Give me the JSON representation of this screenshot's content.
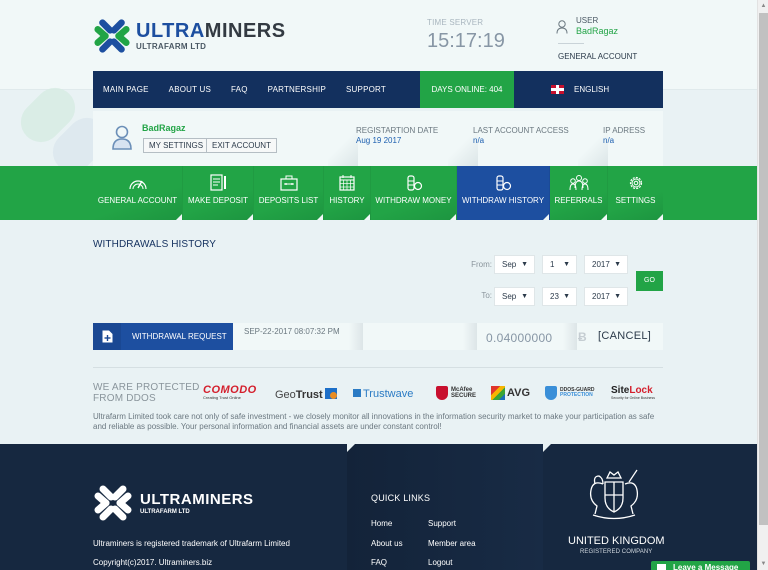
{
  "header": {
    "brand_part1": "ULTRA",
    "brand_part2": "MINERS",
    "brand_sub": "ULTRAFARM LTD",
    "time_label": "TIME SERVER",
    "time_value": "15:17:19",
    "user_label": "USER",
    "user_name": "BadRagaz",
    "account_type": "GENERAL ACCOUNT"
  },
  "nav": {
    "items": [
      {
        "label": "MAIN PAGE"
      },
      {
        "label": "ABOUT US"
      },
      {
        "label": "FAQ"
      },
      {
        "label": "PARTNERSHIP"
      },
      {
        "label": "SUPPORT"
      }
    ],
    "days_online": "DAYS ONLINE: 404",
    "language": "ENGLISH"
  },
  "account": {
    "name": "BadRagaz",
    "settings_button": "MY SETTINGS",
    "exit_button": "EXIT ACCOUNT",
    "reg_label": "REGISTARTION DATE",
    "reg_value": "Aug 19 2017",
    "last_label": "LAST ACCOUNT ACCESS",
    "last_value": "n/a",
    "ip_label": "IP ADRESS",
    "ip_value": "n/a"
  },
  "tabs": [
    {
      "label": "GENERAL ACCOUNT",
      "icon": "gauge-icon",
      "active": false
    },
    {
      "label": "MAKE DEPOSIT",
      "icon": "document-pen-icon",
      "active": false
    },
    {
      "label": "DEPOSITS LIST",
      "icon": "briefcase-icon",
      "active": false
    },
    {
      "label": "HISTORY",
      "icon": "calendar-icon",
      "active": false
    },
    {
      "label": "WITHDRAW MONEY",
      "icon": "coins-icon",
      "active": false
    },
    {
      "label": "WITHDRAW HISTORY",
      "icon": "coins-icon",
      "active": true
    },
    {
      "label": "REFERRALS",
      "icon": "group-icon",
      "active": false
    },
    {
      "label": "SETTINGS",
      "icon": "gear-icon",
      "active": false
    }
  ],
  "content": {
    "title": "WITHDRAWALS HISTORY",
    "filter": {
      "from_label": "From:",
      "to_label": "To:",
      "from_month": "Sep",
      "from_day": "1",
      "from_year": "2017",
      "to_month": "Sep",
      "to_day": "23",
      "to_year": "2017",
      "go_label": "GO"
    },
    "withdrawals": [
      {
        "type": "WITHDRAWAL REQUEST",
        "date": "SEP-22-2017 08:07:32 PM",
        "amount": "0.04000000",
        "currency_symbol": "Ƀ",
        "action": "[CANCEL]"
      }
    ]
  },
  "protection": {
    "title_line1": "WE ARE PROTECTED",
    "title_line2": "FROM DDOS",
    "logos": {
      "comodo": "COMODO",
      "comodo_sub": "Creating Trust Online",
      "geotrust_a": "Geo",
      "geotrust_b": "Trust",
      "trustwave": "Trustwave",
      "mcafee_1": "McAfee",
      "mcafee_2": "SECURE",
      "avg": "AVG",
      "ddosguard_1": "DDOS-GUARD",
      "ddosguard_2": "PROTECTION",
      "sitelock_a": "Site",
      "sitelock_b": "Lock",
      "sitelock_sub": "Security for Online Business"
    },
    "description": "Ultrafarm Limited took care not only of safe investment - we closely monitor all innovations in the information security market to make your participation as safe and reliable as possible. Your personal information and financial assets are under constant control!"
  },
  "footer": {
    "brand": "ULTRAMINERS",
    "brand_sub": "ULTRAFARM LTD",
    "trademark": "Ultraminers is registered trademark of Ultrafarm Limited",
    "copyright": "Copyright(c)2017. Ultraminers.biz",
    "quick_links_title": "QUICK LINKS",
    "quick_links": [
      {
        "label": "Home"
      },
      {
        "label": "Support"
      },
      {
        "label": "About us"
      },
      {
        "label": "Member area"
      },
      {
        "label": "FAQ"
      },
      {
        "label": "Logout"
      }
    ],
    "uk_title": "UNITED KINGDOM",
    "uk_sub": "REGISTERED COMPANY"
  },
  "chat_widget": {
    "label": "Leave a Message"
  },
  "colors": {
    "navy": "#13305e",
    "green": "#22a446",
    "blue_active": "#1d4fa0",
    "footer": "#162840"
  }
}
